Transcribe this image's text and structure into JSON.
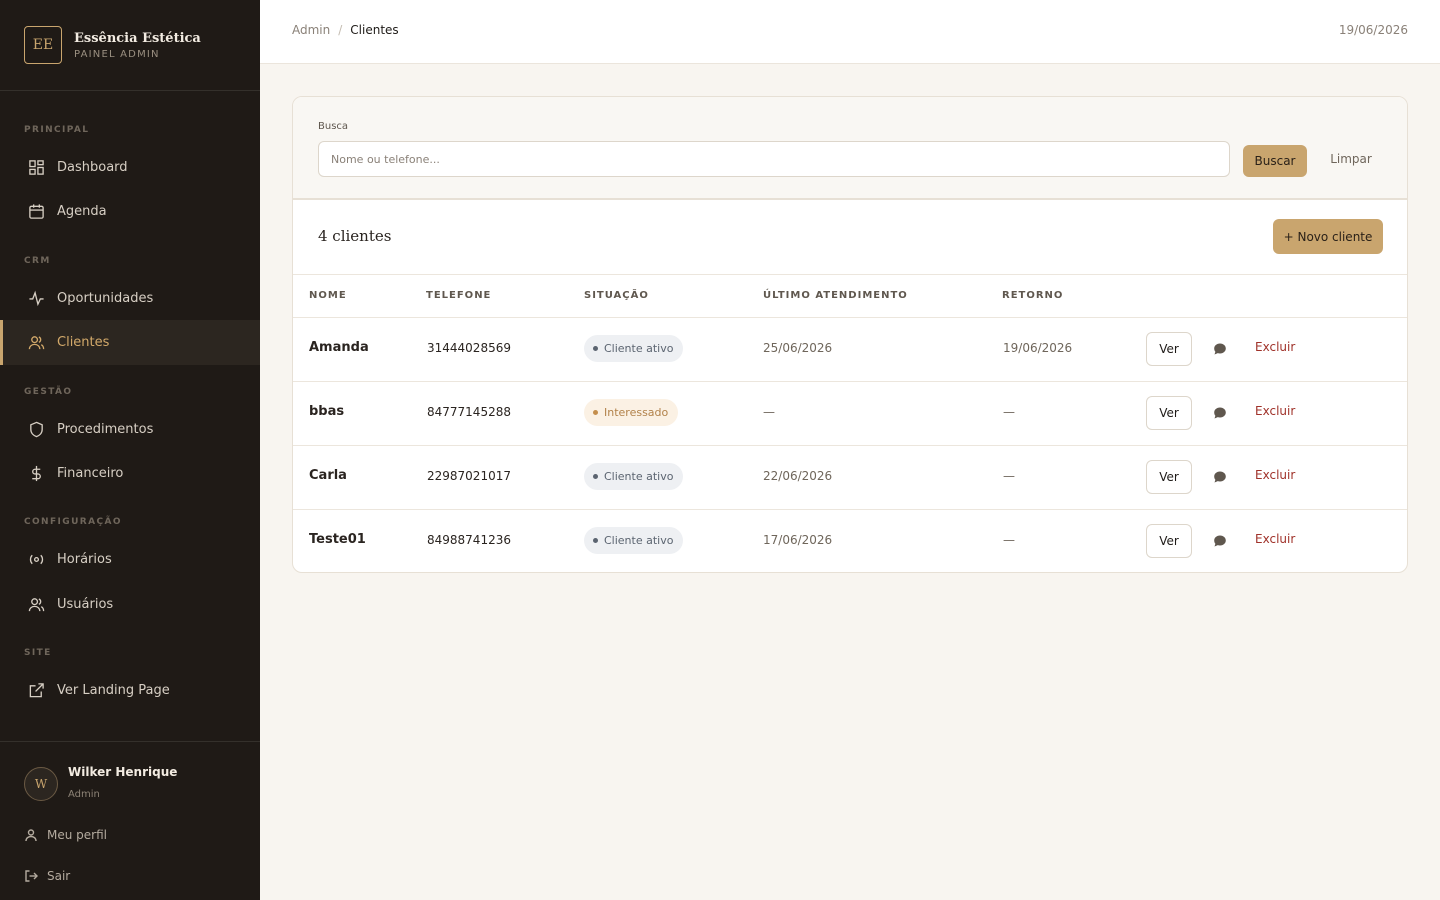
{
  "brand": {
    "logo": "EE",
    "name": "Essência Estética",
    "subtitle": "PAINEL ADMIN"
  },
  "sidebar": {
    "sections": [
      {
        "label": "PRINCIPAL"
      },
      {
        "label": "CRM"
      },
      {
        "label": "GESTÃO"
      },
      {
        "label": "CONFIGURAÇÃO"
      },
      {
        "label": "SITE"
      }
    ],
    "items": [
      {
        "label": "Dashboard",
        "icon": "grid-icon"
      },
      {
        "label": "Agenda",
        "icon": "calendar-icon"
      },
      {
        "label": "Oportunidades",
        "icon": "activity-icon"
      },
      {
        "label": "Clientes",
        "icon": "users-icon",
        "active": true
      },
      {
        "label": "Procedimentos",
        "icon": "shield-icon"
      },
      {
        "label": "Financeiro",
        "icon": "dollar-icon"
      },
      {
        "label": "Horários",
        "icon": "broadcast-icon"
      },
      {
        "label": "Usuários",
        "icon": "users-icon"
      },
      {
        "label": "Ver Landing Page",
        "icon": "external-link-icon"
      }
    ]
  },
  "user": {
    "initial": "W",
    "name": "Wilker Henrique",
    "role": "Admin",
    "profile_label": "Meu perfil",
    "logout_label": "Sair"
  },
  "topbar": {
    "crumb_root": "Admin",
    "crumb_sep": "/",
    "crumb_current": "Clientes",
    "date": "19/06/2026"
  },
  "search": {
    "label": "Busca",
    "placeholder": "Nome ou telefone...",
    "value": "",
    "search_label": "Buscar",
    "clear_label": "Limpar"
  },
  "list": {
    "count_title": "4 clientes",
    "new_label": "+ Novo cliente"
  },
  "table": {
    "headers": [
      "NOME",
      "TELEFONE",
      "SITUAÇÃO",
      "ÚLTIMO ATENDIMENTO",
      "RETORNO"
    ],
    "view_label": "Ver",
    "delete_label": "Excluir",
    "rows": [
      {
        "name": "Amanda",
        "phone": "31444028569",
        "status": "Cliente ativo",
        "last": "25/06/2026",
        "return": "19/06/2026"
      },
      {
        "name": "bbas",
        "phone": "84777145288",
        "status": "Interessado",
        "last": "—",
        "return": "—"
      },
      {
        "name": "Carla",
        "phone": "22987021017",
        "status": "Cliente ativo",
        "last": "22/06/2026",
        "return": "—"
      },
      {
        "name": "Teste01",
        "phone": "84988741236",
        "status": "Cliente ativo",
        "last": "17/06/2026",
        "return": "—"
      }
    ]
  },
  "colors": {
    "accent": "#c9a56e",
    "sidebar_bg": "#1f1a16",
    "danger": "#a0322a",
    "page_bg": "#f8f5f0"
  }
}
